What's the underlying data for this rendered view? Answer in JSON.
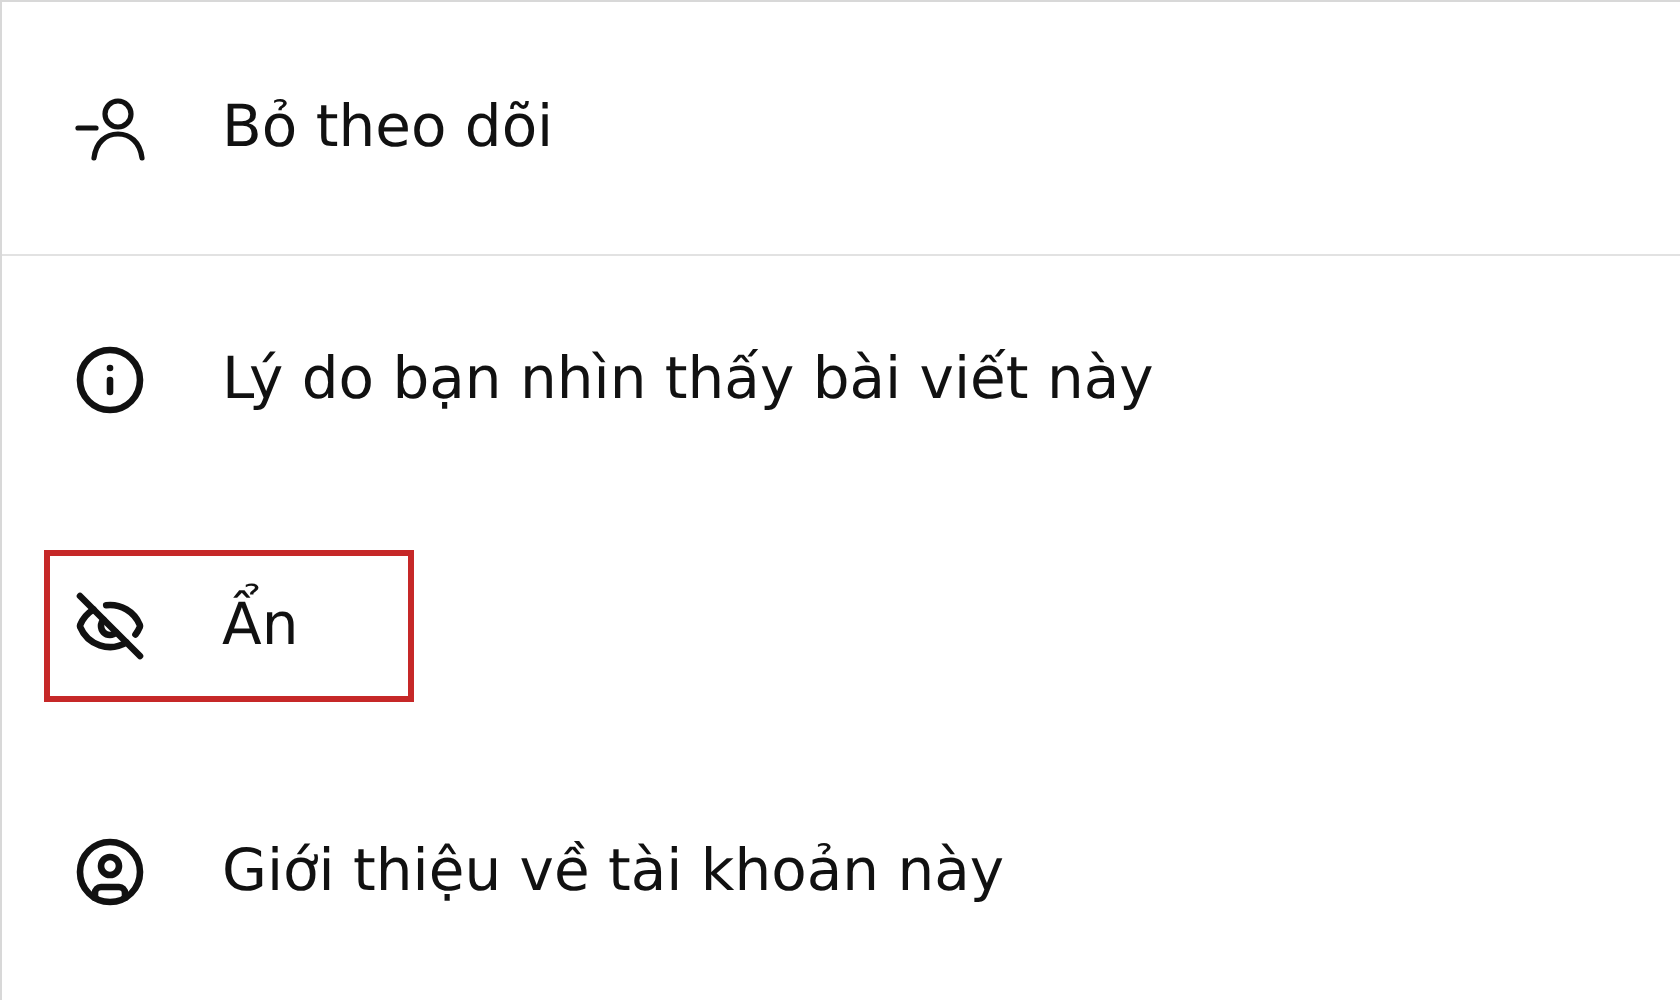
{
  "menu": {
    "sections": [
      {
        "items": [
          {
            "kind": "unfollow",
            "label": "Bỏ theo dõi",
            "highlighted": false
          }
        ]
      },
      {
        "items": [
          {
            "kind": "info",
            "label": "Lý do bạn nhìn thấy bài viết này",
            "highlighted": false
          },
          {
            "kind": "hide",
            "label": "Ẩn",
            "highlighted": true
          },
          {
            "kind": "account",
            "label": "Giới thiệu về tài khoản này",
            "highlighted": false
          }
        ]
      }
    ]
  }
}
